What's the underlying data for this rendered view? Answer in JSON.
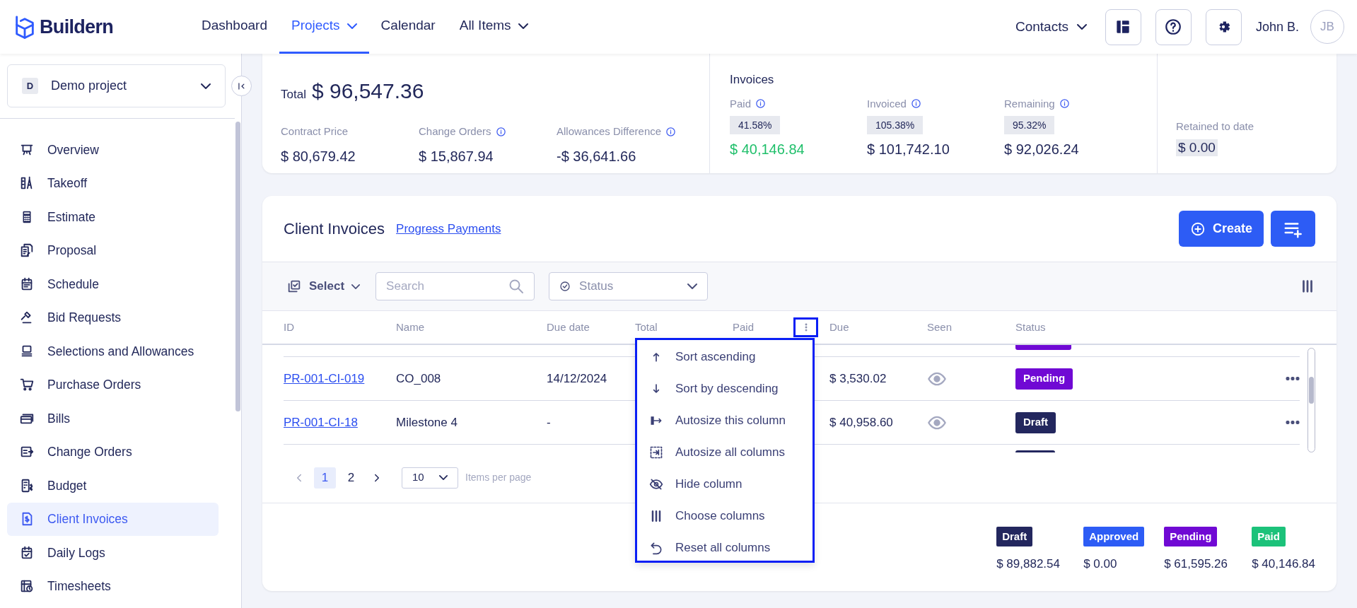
{
  "header": {
    "logo": "Buildern",
    "nav": [
      {
        "label": "Dashboard",
        "selected": false,
        "caret": false
      },
      {
        "label": "Projects",
        "selected": true,
        "caret": true
      },
      {
        "label": "Calendar",
        "selected": false,
        "caret": false
      },
      {
        "label": "All Items",
        "selected": false,
        "caret": true
      }
    ],
    "contacts": "Contacts",
    "user_name": "John B.",
    "avatar": "JB"
  },
  "sidebar": {
    "project": {
      "initial": "D",
      "name": "Demo project"
    },
    "items": [
      {
        "label": "Overview",
        "selected": false
      },
      {
        "label": "Takeoff",
        "selected": false
      },
      {
        "label": "Estimate",
        "selected": false
      },
      {
        "label": "Proposal",
        "selected": false
      },
      {
        "label": "Schedule",
        "selected": false
      },
      {
        "label": "Bid Requests",
        "selected": false
      },
      {
        "label": "Selections and Allowances",
        "selected": false
      },
      {
        "label": "Purchase Orders",
        "selected": false
      },
      {
        "label": "Bills",
        "selected": false
      },
      {
        "label": "Change Orders",
        "selected": false
      },
      {
        "label": "Budget",
        "selected": false
      },
      {
        "label": "Client Invoices",
        "selected": true
      },
      {
        "label": "Daily Logs",
        "selected": false
      },
      {
        "label": "Timesheets",
        "selected": false
      }
    ]
  },
  "summary": {
    "total_label": "Total",
    "total_value": "$ 96,547.36",
    "breakdown": [
      {
        "label": "Contract Price",
        "value": "$ 80,679.42",
        "info": false
      },
      {
        "label": "Change Orders",
        "value": "$ 15,867.94",
        "info": true
      },
      {
        "label": "Allowances Difference",
        "value": "-$ 36,641.66",
        "info": true
      }
    ],
    "invoices": {
      "title": "Invoices",
      "items": [
        {
          "label": "Paid",
          "percent": "41.58%",
          "value": "$ 40,146.84",
          "kind": "paid"
        },
        {
          "label": "Invoiced",
          "percent": "105.38%",
          "value": "$ 101,742.10",
          "kind": "plain"
        },
        {
          "label": "Remaining",
          "percent": "95.32%",
          "value": "$ 92,026.24",
          "kind": "plain"
        }
      ]
    },
    "retained": {
      "label": "Retained to date",
      "value": "$ 0.00"
    }
  },
  "invoices_card": {
    "title": "Client Invoices",
    "link": "Progress Payments",
    "create_label": "Create",
    "toolbar": {
      "select_label": "Select",
      "search_placeholder": "Search",
      "status_placeholder": "Status"
    },
    "columns": [
      {
        "label": "ID",
        "menu_open": false
      },
      {
        "label": "Name",
        "menu_open": false
      },
      {
        "label": "Due date",
        "menu_open": false
      },
      {
        "label": "Total",
        "menu_open": false
      },
      {
        "label": "Paid",
        "menu_open": true
      },
      {
        "label": "Due",
        "menu_open": false
      },
      {
        "label": "Seen",
        "menu_open": false
      },
      {
        "label": "Status",
        "menu_open": false
      }
    ],
    "clipped_above": {
      "kind": "pending"
    },
    "rows": [
      {
        "id": "PR-001-CI-019",
        "name": "CO_008",
        "due_date": "14/12/2024",
        "due": "$ 3,530.02",
        "status": {
          "label": "Pending",
          "kind": "pending"
        }
      },
      {
        "id": "PR-001-CI-18",
        "name": "Milestone 4",
        "due_date": "-",
        "due": "$ 40,958.60",
        "status": {
          "label": "Draft",
          "kind": "draft"
        }
      }
    ],
    "clipped_below": {
      "kind": "draft"
    },
    "pagination": {
      "pages": [
        {
          "label": "1",
          "selected": true
        },
        {
          "label": "2",
          "selected": false
        }
      ],
      "page_size": "10",
      "per_page_label": "Items per page"
    },
    "totals": [
      {
        "label": "Draft",
        "kind": "draft",
        "value": "$ 89,882.54"
      },
      {
        "label": "Approved",
        "kind": "approved",
        "value": "$ 0.00"
      },
      {
        "label": "Pending",
        "kind": "pending",
        "value": "$ 61,595.26"
      },
      {
        "label": "Paid",
        "kind": "paid",
        "value": "$ 40,146.84"
      }
    ]
  },
  "column_menu": {
    "items": [
      {
        "label": "Sort ascending"
      },
      {
        "label": "Sort by descending"
      },
      {
        "label": "Autosize this column"
      },
      {
        "label": "Autosize all columns"
      },
      {
        "label": "Hide column"
      },
      {
        "label": "Choose columns"
      },
      {
        "label": "Reset all columns"
      }
    ]
  }
}
